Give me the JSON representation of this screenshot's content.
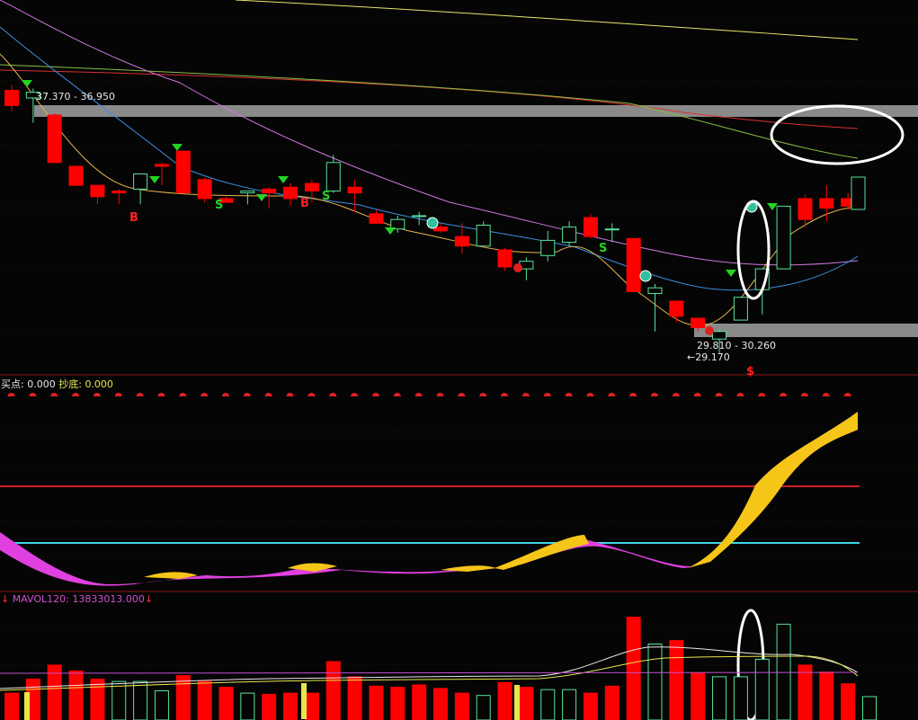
{
  "colors": {
    "up": "#56e39a",
    "down": "#ff0000",
    "bg": "#050505",
    "grid": "#5a1010",
    "band": "#8a8a8a",
    "ma_short": "#e6b54a",
    "ma_mid": "#3a8fe0",
    "ma_long": "#d078e0",
    "ma_top_red": "#d83030",
    "ma_top_green": "#86c040",
    "ma_top_yellow": "#e6e66a",
    "ind_yellow": "#f5c518",
    "ind_magenta": "#e040e0",
    "cyan": "#3fd6e6",
    "vol_white": "#e8e8e8",
    "vol_yellow": "#e6e64a",
    "vol_magenta": "#c050d0"
  },
  "price_panel": {
    "resistance_label": "37.370 - 36.950",
    "support_label": "29.810 - 30.260",
    "low_label": "29.170"
  },
  "indicator_panel": {
    "label_buy": "买点:",
    "value_buy": "0.000",
    "label_bottom": "抄底:",
    "value_bottom": "0.000"
  },
  "volume_panel": {
    "arrow": "↓",
    "label": "MAVOL120: 13833013.000",
    "arrow_end": "↓"
  },
  "chart_data": {
    "type": "candlestick",
    "bars": 40,
    "ohlc": [
      [
        38.3,
        38.6,
        37.2,
        37.5
      ],
      [
        37.9,
        38.4,
        36.6,
        38.2
      ],
      [
        37.0,
        37.1,
        34.5,
        34.5
      ],
      [
        34.3,
        34.3,
        33.3,
        33.3
      ],
      [
        33.3,
        33.3,
        32.3,
        32.7
      ],
      [
        33.0,
        33.1,
        32.3,
        32.9
      ],
      [
        33.1,
        33.9,
        32.3,
        33.9
      ],
      [
        34.4,
        34.5,
        33.3,
        34.3
      ],
      [
        35.1,
        35.1,
        32.9,
        32.9
      ],
      [
        33.6,
        33.7,
        32.4,
        32.6
      ],
      [
        32.6,
        32.7,
        32.4,
        32.4
      ],
      [
        32.9,
        33.0,
        32.3,
        33.0
      ],
      [
        33.1,
        33.2,
        32.1,
        32.9
      ],
      [
        33.2,
        33.4,
        32.2,
        32.6
      ],
      [
        33.4,
        33.6,
        32.4,
        33.0
      ],
      [
        33.0,
        34.9,
        32.9,
        34.5
      ],
      [
        33.2,
        33.6,
        31.9,
        32.9
      ],
      [
        31.8,
        32.0,
        31.3,
        31.3
      ],
      [
        31.0,
        31.7,
        30.8,
        31.5
      ],
      [
        31.7,
        31.9,
        31.2,
        31.7
      ],
      [
        31.1,
        31.3,
        30.8,
        30.9
      ],
      [
        30.6,
        31.3,
        29.7,
        30.1
      ],
      [
        30.1,
        31.4,
        30.1,
        31.2
      ],
      [
        29.9,
        30.0,
        28.8,
        29.0
      ],
      [
        28.9,
        29.5,
        28.3,
        29.3
      ],
      [
        29.6,
        30.9,
        29.3,
        30.4
      ],
      [
        30.3,
        31.4,
        30.1,
        31.1
      ],
      [
        31.6,
        31.8,
        30.5,
        30.6
      ],
      [
        31.0,
        31.3,
        30.3,
        31.0
      ],
      [
        30.5,
        30.5,
        27.7,
        27.7
      ],
      [
        27.6,
        28.1,
        25.6,
        27.9
      ],
      [
        27.2,
        27.2,
        26.1,
        26.4
      ],
      [
        26.3,
        26.3,
        25.6,
        25.8
      ],
      [
        25.2,
        25.7,
        24.4,
        25.6
      ],
      [
        26.2,
        27.4,
        26.2,
        27.4
      ],
      [
        27.8,
        28.9,
        26.5,
        28.9
      ],
      [
        28.9,
        32.2,
        28.9,
        32.2
      ],
      [
        32.6,
        32.8,
        31.1,
        31.5
      ],
      [
        32.6,
        33.3,
        31.4,
        32.1
      ],
      [
        32.6,
        32.9,
        32.0,
        32.2
      ]
    ],
    "last_bar_close": 33.2,
    "volume_type": "bar",
    "volume": [
      23,
      35,
      47,
      42,
      35,
      33,
      33,
      25,
      38,
      33,
      28,
      23,
      22,
      23,
      23,
      50,
      37,
      29,
      28,
      30,
      27,
      23,
      21,
      32,
      28,
      26,
      26,
      23,
      29,
      88,
      65,
      68,
      40,
      37,
      37,
      52,
      82,
      47,
      41,
      31,
      20
    ],
    "volume_up": [
      false,
      false,
      false,
      false,
      false,
      true,
      true,
      true,
      false,
      false,
      false,
      true,
      false,
      false,
      false,
      false,
      false,
      false,
      false,
      false,
      false,
      false,
      true,
      false,
      false,
      true,
      true,
      false,
      false,
      false,
      true,
      false,
      false,
      true,
      true,
      true,
      true,
      false,
      false,
      false,
      true
    ]
  }
}
